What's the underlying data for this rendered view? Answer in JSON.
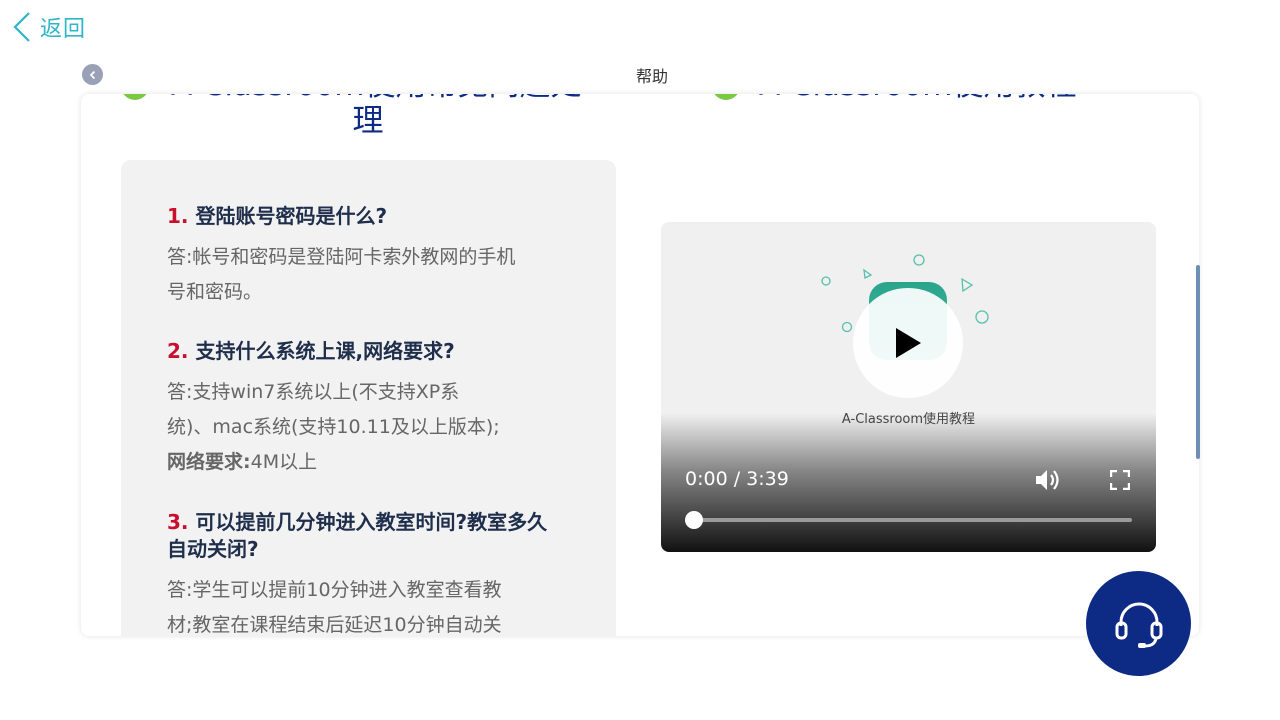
{
  "header": {
    "back_label": "返回",
    "title": "帮助"
  },
  "sections": {
    "faq_title_top": "A-Classroom使用常见问题处",
    "faq_title_bottom": "理",
    "tutorial_title": "A-Classroom使用教程"
  },
  "faq": [
    {
      "num": "1.",
      "question": "登陆账号密码是什么?",
      "answer_line1": "答:帐号和密码是登陆阿卡索外教网的手机",
      "answer_line2": "号和密码。"
    },
    {
      "num": "2.",
      "question": "支持什么系统上课,网络要求?",
      "answer_line1": "答:支持win7系统以上(不支持XP系",
      "answer_line2": "统)、mac系统(支持10.11及以上版本);",
      "answer_line3_bold": "网络要求:",
      "answer_line3_rest": "4M以上"
    },
    {
      "num": "3.",
      "question": "可以提前几分钟进入教室时间?教室多久自动关闭?",
      "answer_line1": "答:学生可以提前10分钟进入教室查看教",
      "answer_line2": "材;教室在课程结束后延迟10分钟自动关"
    }
  ],
  "video": {
    "caption": "A-Classroom使用教程",
    "time": "0:00 / 3:39",
    "progress": 0
  },
  "colors": {
    "accent": "#2fb5c8",
    "title_blue": "#0d2b84",
    "question_red": "#c8102e",
    "bullet_green": "#7ac943"
  },
  "icons": {
    "back": "chevron-left-icon",
    "collapse": "chevron-left-circle-icon",
    "play": "play-icon",
    "volume": "volume-icon",
    "fullscreen": "fullscreen-icon",
    "support": "headset-icon"
  }
}
